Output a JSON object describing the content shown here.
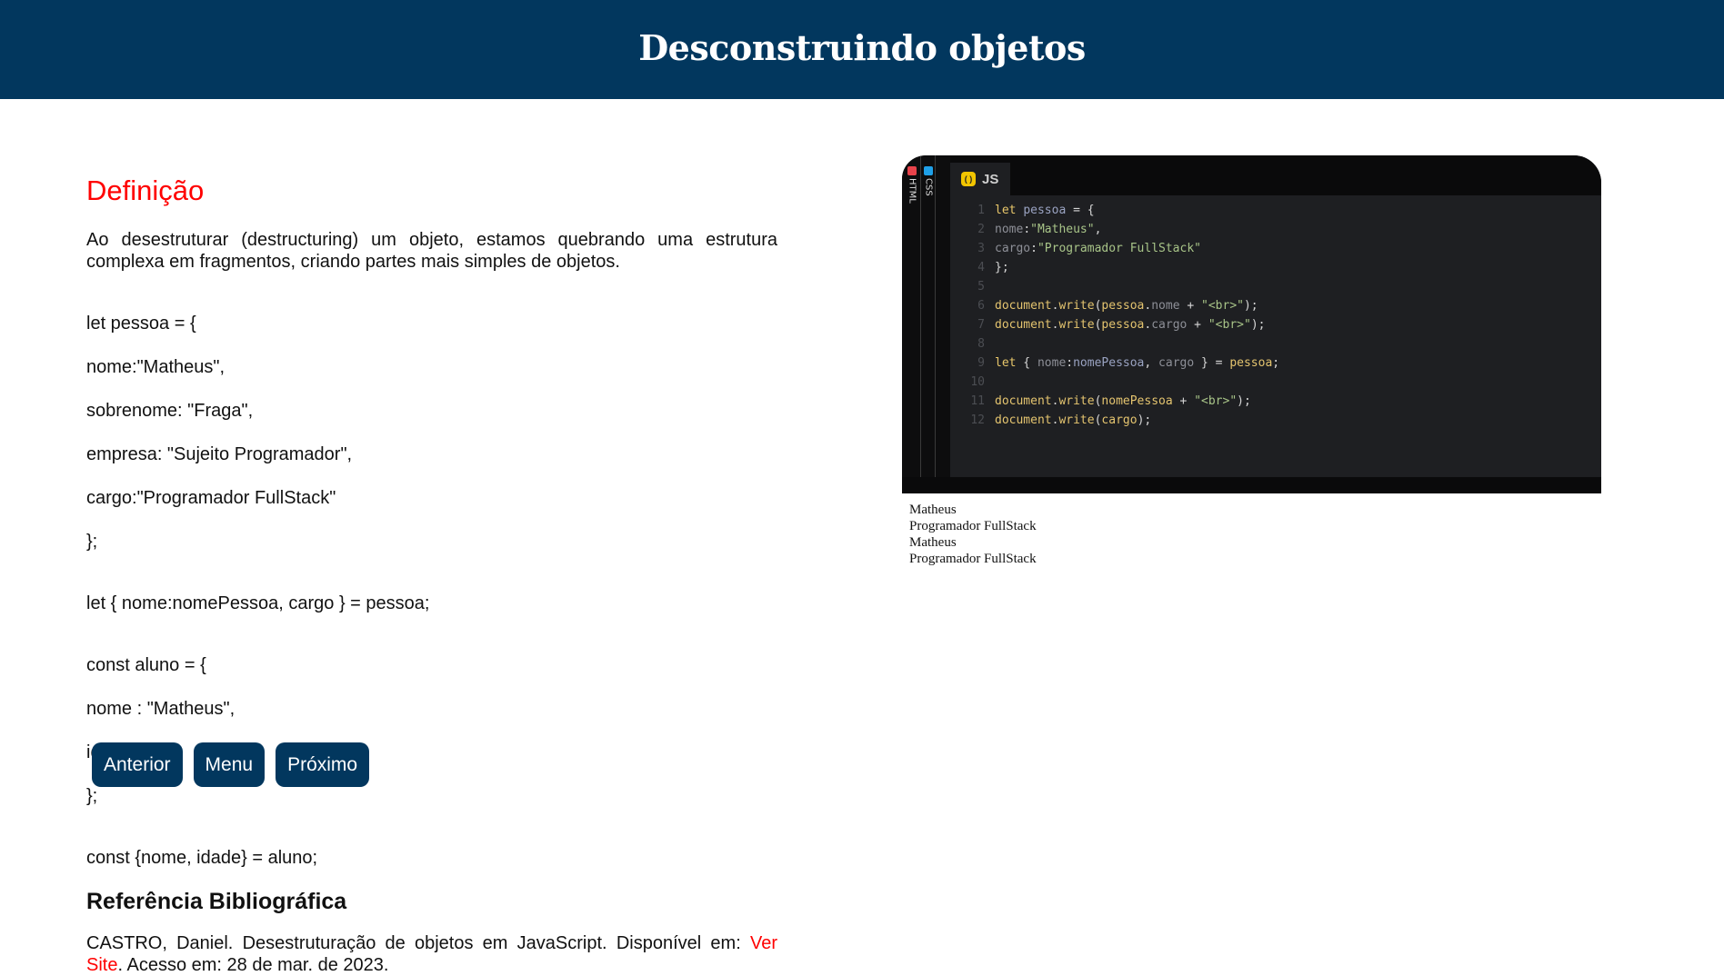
{
  "header": {
    "title": "Desconstruindo objetos"
  },
  "main": {
    "section_title": "Definição",
    "intro": "Ao desestruturar (destructuring) um objeto, estamos quebrando uma estrutura complexa em fragmentos, criando partes mais simples de objetos.",
    "code1": [
      "let pessoa = {",
      "nome:\"Matheus\",",
      "sobrenome: \"Fraga\",",
      "empresa: \"Sujeito Programador\",",
      "cargo:\"Programador FullStack\"",
      "};"
    ],
    "code2": "let { nome:nomePessoa, cargo } = pessoa;",
    "code3": [
      "const aluno = {",
      "nome : \"Matheus\",",
      "idade : \"23\"",
      "};"
    ],
    "code4": "const {nome, idade} = aluno;",
    "ref_title": "Referência Bibliográfica",
    "ref_text_before": "CASTRO, Daniel. Desestruturação de objetos em JavaScript. Disponível em: ",
    "ref_link": "Ver Site",
    "ref_text_after": ". Acesso em: 28 de mar. de 2023."
  },
  "nav": {
    "prev": "Anterior",
    "menu": "Menu",
    "next": "Próximo"
  },
  "editor": {
    "tabs": {
      "html": "HTML",
      "css": "CSS",
      "js": "JS"
    },
    "line_numbers": [
      "1",
      "2",
      "3",
      "4",
      "5",
      "6",
      "7",
      "8",
      "9",
      "10",
      "11",
      "12"
    ],
    "code_lines": [
      "let pessoa = {",
      "nome:\"Matheus\",",
      "cargo:\"Programador FullStack\"",
      "};",
      "",
      "document.write(pessoa.nome + \"<br>\");",
      "document.write(pessoa.cargo + \"<br>\");",
      "",
      "let { nome:nomePessoa, cargo } = pessoa;",
      "",
      "document.write(nomePessoa + \"<br>\");",
      "document.write(cargo);"
    ]
  },
  "output": [
    "Matheus",
    "Programador FullStack",
    "Matheus",
    "Programador FullStack"
  ],
  "colors": {
    "header_bg": "#02375e",
    "accent_red": "#ff0000",
    "button_bg": "#02375e",
    "editor_bg": "#1e1f22"
  }
}
